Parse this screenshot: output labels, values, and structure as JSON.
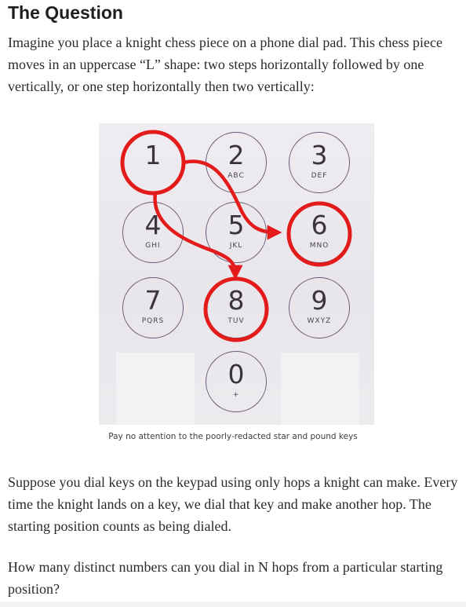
{
  "article": {
    "heading": "The Question",
    "para1": "Imagine you place a knight chess piece on a phone dial pad. This chess piece moves in an uppercase “L” shape: two steps horizontally followed by one vertically, or one step horizontally then two vertically:",
    "caption": "Pay no attention to the poorly-redacted star and pound keys",
    "para2": "Suppose you dial keys on the keypad using only hops a knight can make. Every time the knight lands on a key, we dial that key and make another hop. The starting position counts as being dialed.",
    "para3": "How many distinct numbers can you dial in N hops from a particular starting position?"
  },
  "keypad": {
    "keys": [
      {
        "digit": "1",
        "letters": ""
      },
      {
        "digit": "2",
        "letters": "ABC"
      },
      {
        "digit": "3",
        "letters": "DEF"
      },
      {
        "digit": "4",
        "letters": "GHI"
      },
      {
        "digit": "5",
        "letters": "JKL"
      },
      {
        "digit": "6",
        "letters": "MNO"
      },
      {
        "digit": "7",
        "letters": "PQRS"
      },
      {
        "digit": "8",
        "letters": "TUV"
      },
      {
        "digit": "9",
        "letters": "WXYZ"
      },
      {
        "digit": "0",
        "letters": "+"
      }
    ],
    "highlighted": [
      "1",
      "6",
      "8"
    ],
    "moves": [
      {
        "from": "1",
        "to": "6"
      },
      {
        "from": "1",
        "to": "8"
      }
    ],
    "colors": {
      "highlight": "#e41b1b",
      "ring": "#6a5a78",
      "background": "#ece9ee"
    }
  }
}
